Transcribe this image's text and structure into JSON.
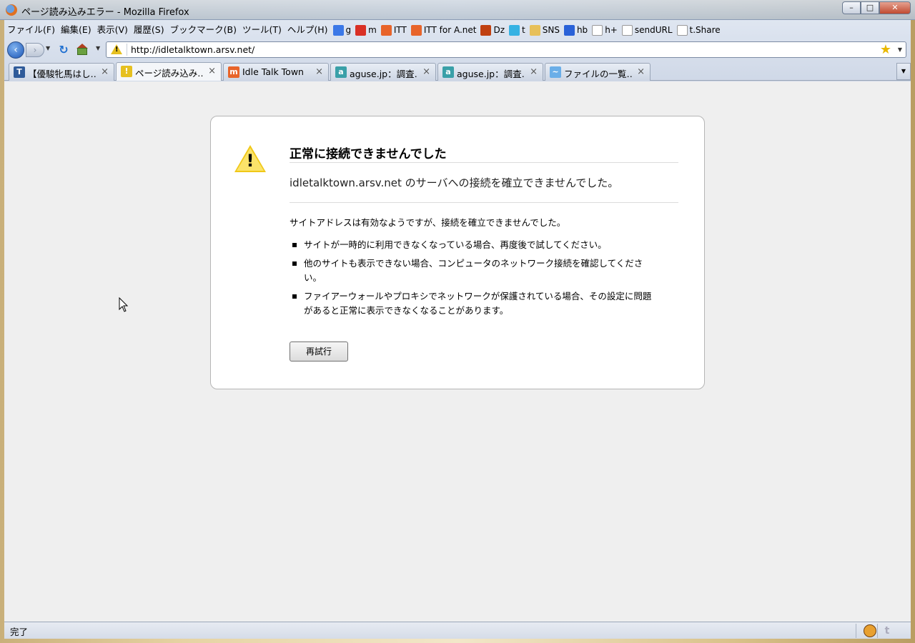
{
  "window": {
    "title": "ページ読み込みエラー - Mozilla Firefox",
    "buttons": {
      "minimize": "–",
      "maximize": "□",
      "close": "✕"
    }
  },
  "menu": [
    "ファイル(F)",
    "編集(E)",
    "表示(V)",
    "履歴(S)",
    "ブックマーク(B)",
    "ツール(T)",
    "ヘルプ(H)"
  ],
  "bookmarks": [
    {
      "label": "g",
      "icon": "google-icon",
      "color": "#3b78e7"
    },
    {
      "label": "m",
      "icon": "gmail-icon",
      "color": "#d93025"
    },
    {
      "label": "ITT",
      "icon": "itt-icon",
      "color": "#e8642a"
    },
    {
      "label": "ITT for A.net",
      "icon": "itt-icon",
      "color": "#e8642a"
    },
    {
      "label": "Dz",
      "icon": "dz-icon",
      "color": "#c04010"
    },
    {
      "label": "t",
      "icon": "twitter-icon",
      "color": "#35b2e3"
    },
    {
      "label": "SNS",
      "icon": "folder-icon",
      "color": "#e7c05a"
    },
    {
      "label": "hb",
      "icon": "hatena-icon",
      "color": "#2a62d8"
    },
    {
      "label": "h+",
      "icon": "page-icon",
      "color": "#ffffff"
    },
    {
      "label": "sendURL",
      "icon": "page-icon",
      "color": "#ffffff"
    },
    {
      "label": "t.Share",
      "icon": "page-icon",
      "color": "#ffffff"
    }
  ],
  "nav": {
    "back": "‹",
    "forward": "›",
    "reload": "↻",
    "url": "http://idletalktown.arsv.net/",
    "star": "★"
  },
  "tabs": [
    {
      "label": "【優駿牝馬はし…",
      "icon_text": "T",
      "icon_color": "#2f5b9a",
      "active": false
    },
    {
      "label": "ページ読み込み…",
      "icon_text": "!",
      "icon_color": "#e6c020",
      "active": true
    },
    {
      "label": "Idle Talk Town",
      "icon_text": "m",
      "icon_color": "#e8642a",
      "active": false
    },
    {
      "label": "aguse.jp：調査…",
      "icon_text": "a",
      "icon_color": "#3aa0a8",
      "active": false
    },
    {
      "label": "aguse.jp：調査…",
      "icon_text": "a",
      "icon_color": "#3aa0a8",
      "active": false
    },
    {
      "label": "ファイルの一覧…",
      "icon_text": "~",
      "icon_color": "#6aaee8",
      "active": false
    }
  ],
  "error": {
    "title": "正常に接続できませんでした",
    "short": "idletalktown.arsv.net のサーバへの接続を確立できませんでした。",
    "desc": "サイトアドレスは有効なようですが、接続を確立できませんでした。",
    "items": [
      "サイトが一時的に利用できなくなっている場合、再度後で試してください。",
      "他のサイトも表示できない場合、コンピュータのネットワーク接続を確認してください。",
      "ファイアーウォールやプロキシでネットワークが保護されている場合、その設定に問題があると正常に表示できなくなることがあります。"
    ],
    "retry": "再試行"
  },
  "status": {
    "text": "完了"
  }
}
